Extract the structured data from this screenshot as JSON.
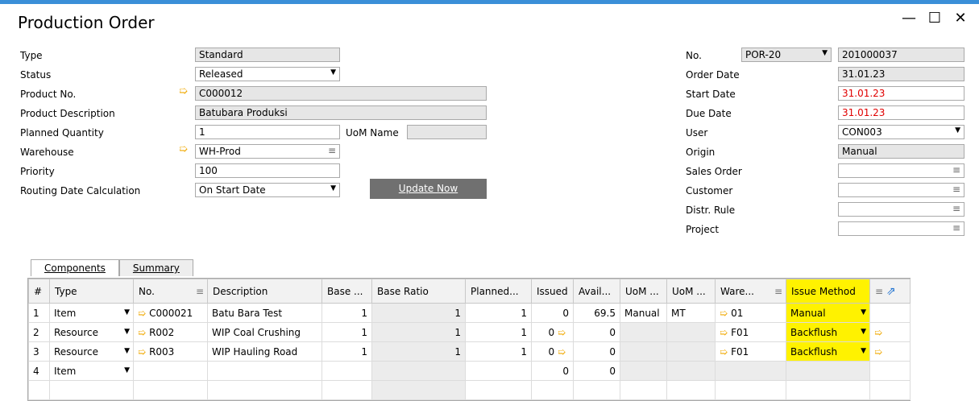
{
  "window": {
    "title": "Production Order",
    "minimize": "—",
    "maximize": "☐",
    "close": "✕"
  },
  "left": {
    "type_label": "Type",
    "type_value": "Standard",
    "status_label": "Status",
    "status_value": "Released",
    "product_no_label": "Product No.",
    "product_no_value": "C000012",
    "product_desc_label": "Product Description",
    "product_desc_value": "Batubara Produksi",
    "planned_qty_label": "Planned Quantity",
    "planned_qty_value": "1",
    "uom_name_label": "UoM Name",
    "uom_name_value": "",
    "warehouse_label": "Warehouse",
    "warehouse_value": "WH-Prod",
    "priority_label": "Priority",
    "priority_value": "100",
    "routing_label": "Routing Date Calculation",
    "routing_value": "On Start Date",
    "update_button": "Update Now"
  },
  "right": {
    "no_label": "No.",
    "no_series": "POR-20",
    "no_value": "201000037",
    "order_date_label": "Order Date",
    "order_date_value": "31.01.23",
    "start_date_label": "Start Date",
    "start_date_value": "31.01.23",
    "due_date_label": "Due Date",
    "due_date_value": "31.01.23",
    "user_label": "User",
    "user_value": "CON003",
    "origin_label": "Origin",
    "origin_value": "Manual",
    "sales_order_label": "Sales Order",
    "sales_order_value": "",
    "customer_label": "Customer",
    "customer_value": "",
    "distr_rule_label": "Distr. Rule",
    "distr_rule_value": "",
    "project_label": "Project",
    "project_value": ""
  },
  "tabs": {
    "components": "Components",
    "summary": "Summary"
  },
  "grid": {
    "headers": [
      "#",
      "Type",
      "No.",
      "Description",
      "Base ...",
      "Base Ratio",
      "Planned...",
      "Issued",
      "Avail...",
      "UoM ...",
      "UoM ...",
      "Ware...",
      "Issue Method"
    ],
    "rows": [
      {
        "n": "1",
        "type": "Item",
        "no": "C000021",
        "desc": "Batu Bara Test",
        "base": "1",
        "ratio": "1",
        "planned": "1",
        "issued": "0",
        "avail": "69.5",
        "uom1": "Manual",
        "uom2": "MT",
        "wh": "01",
        "method": "Manual"
      },
      {
        "n": "2",
        "type": "Resource",
        "no": "R002",
        "desc": "WIP Coal Crushing",
        "base": "1",
        "ratio": "1",
        "planned": "1",
        "issued": "0",
        "avail": "0",
        "uom1": "",
        "uom2": "",
        "wh": "F01",
        "method": "Backflush"
      },
      {
        "n": "3",
        "type": "Resource",
        "no": "R003",
        "desc": "WIP Hauling Road",
        "base": "1",
        "ratio": "1",
        "planned": "1",
        "issued": "0",
        "avail": "0",
        "uom1": "",
        "uom2": "",
        "wh": "F01",
        "method": "Backflush"
      },
      {
        "n": "4",
        "type": "Item",
        "no": "",
        "desc": "",
        "base": "",
        "ratio": "",
        "planned": "",
        "issued": "0",
        "avail": "0",
        "uom1": "",
        "uom2": "",
        "wh": "",
        "method": ""
      }
    ]
  },
  "colors": {
    "accent": "#3a8fd8",
    "highlight": "#fff200",
    "link_arrow": "#f0a800",
    "date_red": "#e00000"
  }
}
